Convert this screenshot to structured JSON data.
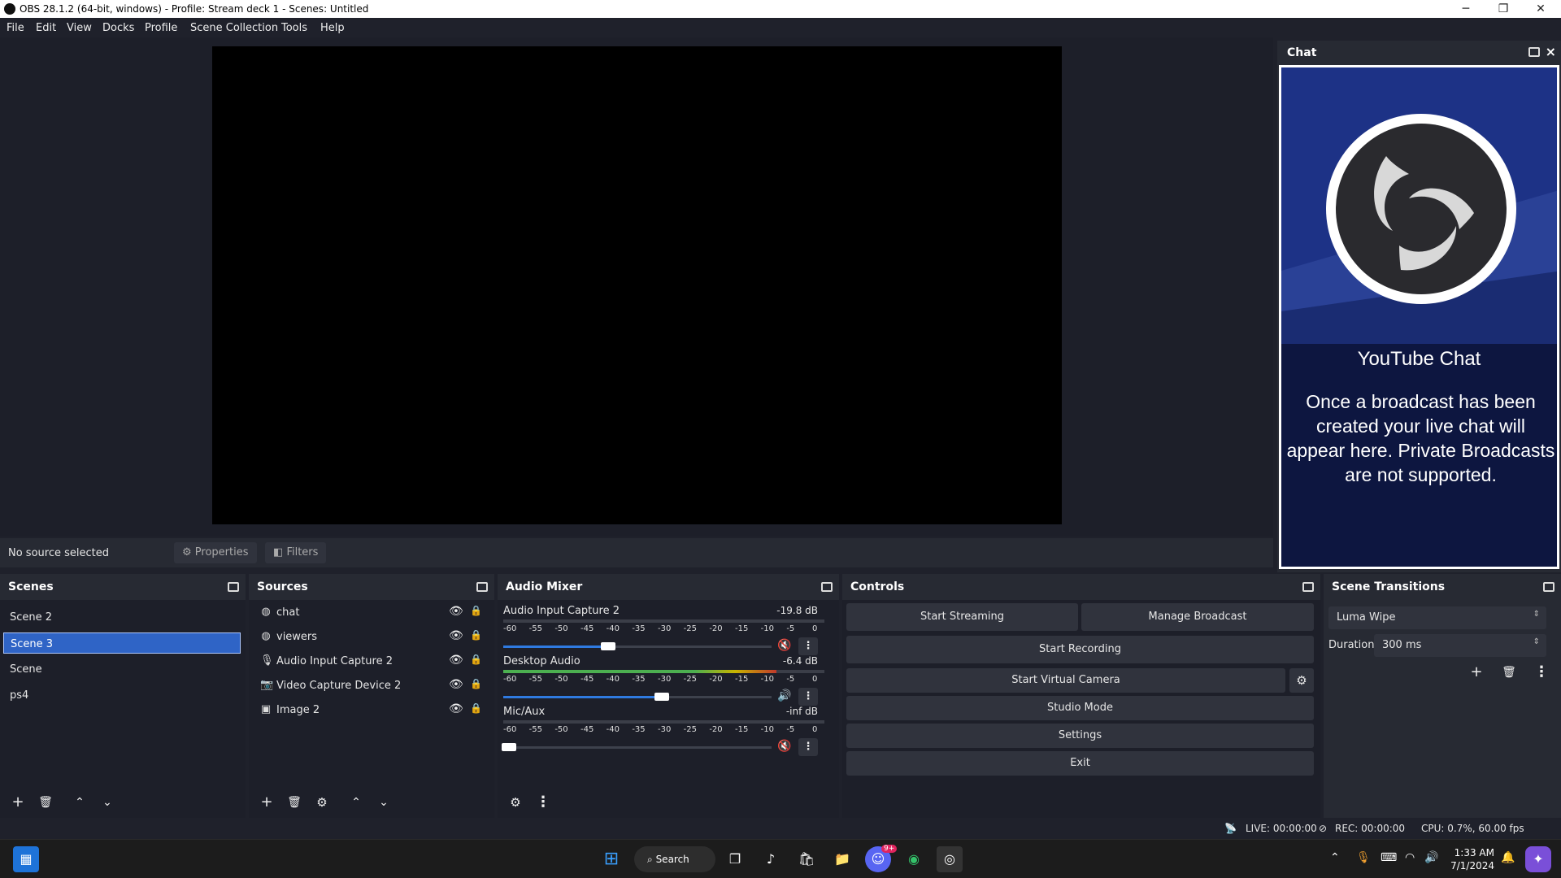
{
  "window": {
    "title": "OBS 28.1.2 (64-bit, windows) - Profile: Stream deck 1 - Scenes: Untitled",
    "controls": [
      "─",
      "❐",
      "✕"
    ]
  },
  "menu": [
    "File",
    "Edit",
    "View",
    "Docks",
    "Profile",
    "Scene Collection",
    "Tools",
    "Help"
  ],
  "source_toolbar": {
    "status": "No source selected",
    "properties_label": "Properties",
    "filters_label": "Filters"
  },
  "chat": {
    "dock_title": "Chat",
    "heading": "YouTube Chat",
    "message": "Once a broadcast has been created your live chat will appear here. Private Broadcasts are not supported."
  },
  "scenes": {
    "title": "Scenes",
    "items": [
      "Scene 2",
      "Scene 3",
      "Scene",
      "ps4"
    ],
    "selected": "Scene 3"
  },
  "sources": {
    "title": "Sources",
    "items": [
      {
        "name": "chat",
        "icon": "globe-icon"
      },
      {
        "name": "viewers",
        "icon": "globe-icon"
      },
      {
        "name": "Audio Input Capture 2",
        "icon": "microphone-icon"
      },
      {
        "name": "Video Capture Device 2",
        "icon": "camera-icon"
      },
      {
        "name": "Image 2",
        "icon": "image-icon"
      }
    ]
  },
  "mixer": {
    "title": "Audio Mixer",
    "scale": [
      "-60",
      "-55",
      "-50",
      "-45",
      "-40",
      "-35",
      "-30",
      "-25",
      "-20",
      "-15",
      "-10",
      "-5",
      "0"
    ],
    "channels": [
      {
        "name": "Audio Input Capture 2",
        "db": "-19.8 dB",
        "volume": 0.39,
        "muted": true,
        "level": 0
      },
      {
        "name": "Desktop Audio",
        "db": "-6.4 dB",
        "volume": 0.59,
        "muted": false,
        "level": 0.85
      },
      {
        "name": "Mic/Aux",
        "db": "-inf dB",
        "volume": 0.02,
        "muted": true,
        "level": 0
      }
    ]
  },
  "controls": {
    "title": "Controls",
    "start_streaming": "Start Streaming",
    "manage_broadcast": "Manage Broadcast",
    "start_recording": "Start Recording",
    "start_virtual_camera": "Start Virtual Camera",
    "studio_mode": "Studio Mode",
    "settings": "Settings",
    "exit": "Exit"
  },
  "transitions": {
    "title": "Scene Transitions",
    "selected": "Luma Wipe",
    "duration_label": "Duration",
    "duration_value": "300 ms"
  },
  "status": {
    "live": "LIVE: 00:00:00",
    "rec": "REC: 00:00:00",
    "cpu": "CPU: 0.7%, 60.00 fps"
  },
  "taskbar": {
    "search_label": "Search",
    "time": "1:33 AM",
    "date": "7/1/2024",
    "discord_badge": "9+"
  },
  "colors": {
    "accent": "#2f64c6",
    "muted_red": "#d0302f",
    "meter_green": "#4caf50",
    "meter_yellow": "#c8b400",
    "meter_red": "#c0392b"
  }
}
